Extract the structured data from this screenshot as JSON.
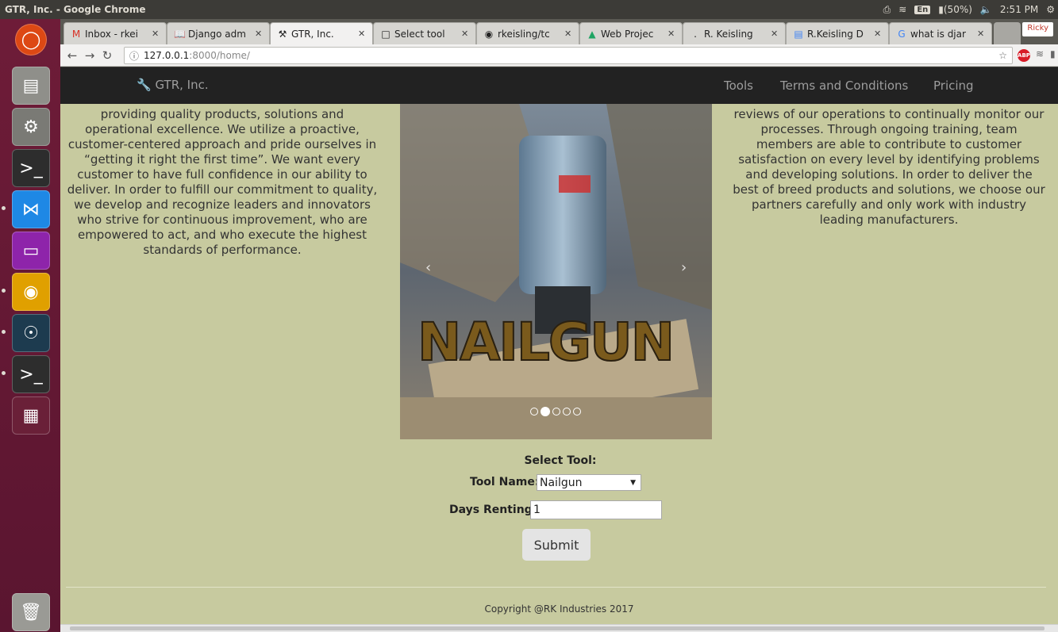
{
  "os": {
    "window_title": "GTR, Inc. - Google Chrome",
    "keyboard": "En",
    "battery": "(50%)",
    "clock": "2:51 PM"
  },
  "browser": {
    "tabs": [
      {
        "label": "Inbox - rkei",
        "icon": "gmail-icon"
      },
      {
        "label": "Django adm",
        "icon": "book-icon"
      },
      {
        "label": "GTR, Inc.",
        "icon": "tools-icon"
      },
      {
        "label": "Select tool",
        "icon": "page-icon"
      },
      {
        "label": "rkeisling/tc",
        "icon": "github-icon"
      },
      {
        "label": "Web Projec",
        "icon": "drive-icon"
      },
      {
        "label": "R. Keisling",
        "icon": "dot-icon"
      },
      {
        "label": "R.Keisling D",
        "icon": "docs-icon"
      },
      {
        "label": "what is djar",
        "icon": "google-icon"
      }
    ],
    "user": "Ricky",
    "url_host": "127.0.0.1",
    "url_path": ":8000/home/"
  },
  "site": {
    "brand": "GTR, Inc.",
    "nav": [
      "Tools",
      "Terms and Conditions",
      "Pricing"
    ],
    "left_text": [
      "providing quality products, solutions and",
      "operational excellence. We utilize a proactive,",
      "customer-centered approach and pride ourselves in",
      "“getting it right the first time”. We want every",
      "customer to have full confidence in our ability to",
      "deliver. In order to fulfill our commitment to quality,",
      "we develop and recognize leaders and innovators",
      "who strive for continuous improvement, who are",
      "empowered to act, and who execute the highest",
      "standards of performance."
    ],
    "right_text": [
      "reviews of our operations to continually monitor our",
      "processes. Through ongoing training, team",
      "members are able to contribute to customer",
      "satisfaction on every level by identifying problems",
      "and developing solutions. In order to deliver the",
      "best of breed products and solutions, we choose our",
      "partners carefully and only work with industry",
      "leading manufacturers."
    ],
    "carousel": {
      "caption": "NAILGUN",
      "slide_count": 5,
      "active_index": 1
    },
    "form": {
      "title": "Select Tool:",
      "tool_label": "Tool Name:",
      "tool_value": "Nailgun",
      "days_label": "Days Renting:",
      "days_value": "1",
      "submit_label": "Submit"
    },
    "copyright": "Copyright @RK Industries 2017"
  }
}
